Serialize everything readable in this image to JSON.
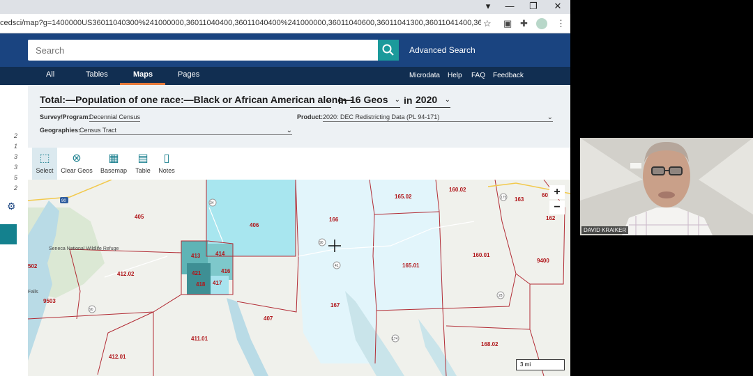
{
  "browser": {
    "url": "cedsci/map?g=1400000US36011040300%241000000,36011040400,36011040400%241000000,36011040600,36011041300,36011041400,36011041...",
    "window_buttons": [
      "▾",
      "—",
      "❐",
      "✕"
    ],
    "icons": [
      "star-icon",
      "extensions-icon",
      "puzzle-icon",
      "profile-icon",
      "menu-icon"
    ]
  },
  "header": {
    "search_placeholder": "Search",
    "advanced_search": "Advanced Search"
  },
  "nav": {
    "tabs": [
      "All",
      "Tables",
      "Maps",
      "Pages"
    ],
    "active_tab": "Maps",
    "links": [
      "Microdata",
      "Help",
      "FAQ",
      "Feedback"
    ]
  },
  "left_rail": {
    "numbers": [
      "2",
      "1",
      "3",
      "3",
      "5",
      "2"
    ]
  },
  "filters": {
    "table_title": "Total:—Population of one race:—Black or African American alone—",
    "in1": "in",
    "geos": "16 Geos",
    "in2": "in",
    "year": "2020",
    "survey_label": "Survey/Program:",
    "survey_value": "Decennial Census",
    "product_label": "Product:",
    "product_value": "2020: DEC Redistricting Data (PL 94-171)",
    "geographies_label": "Geographies:",
    "geographies_value": "Census Tract"
  },
  "toolbar": {
    "tools": [
      {
        "label": "Select",
        "icon": "select-icon",
        "selected": true
      },
      {
        "label": "Clear Geos",
        "icon": "clear-icon",
        "selected": false
      },
      {
        "label": "Basemap",
        "icon": "basemap-icon",
        "selected": false
      },
      {
        "label": "Table",
        "icon": "table-icon",
        "selected": false
      },
      {
        "label": "Notes",
        "icon": "notes-icon",
        "selected": false
      }
    ]
  },
  "map": {
    "tracts": [
      "405",
      "406",
      "166",
      "165.02",
      "160.02",
      "163",
      "162",
      "413",
      "414",
      "416",
      "421",
      "418",
      "417",
      "412.02",
      "165.01",
      "160.01",
      "9400",
      "502",
      "9503",
      "407",
      "167",
      "411.01",
      "412.01",
      "168.02",
      "60"
    ],
    "place_labels": [
      "Seneca National Wildlife Refuge",
      "Falls"
    ],
    "route_shields": [
      "90",
      "34",
      "90",
      "41",
      "90",
      "174",
      "28",
      "175"
    ],
    "zoom_in": "+",
    "zoom_out": "−",
    "scale": "3 mi",
    "colors": {
      "light": "#d7f1f8",
      "medium": "#a8e3ee",
      "dark": "#5fb4b6",
      "darker": "#3e8f94",
      "border": "#b22c35"
    }
  },
  "webcam": {
    "name": "DAVID KRAIKER"
  }
}
